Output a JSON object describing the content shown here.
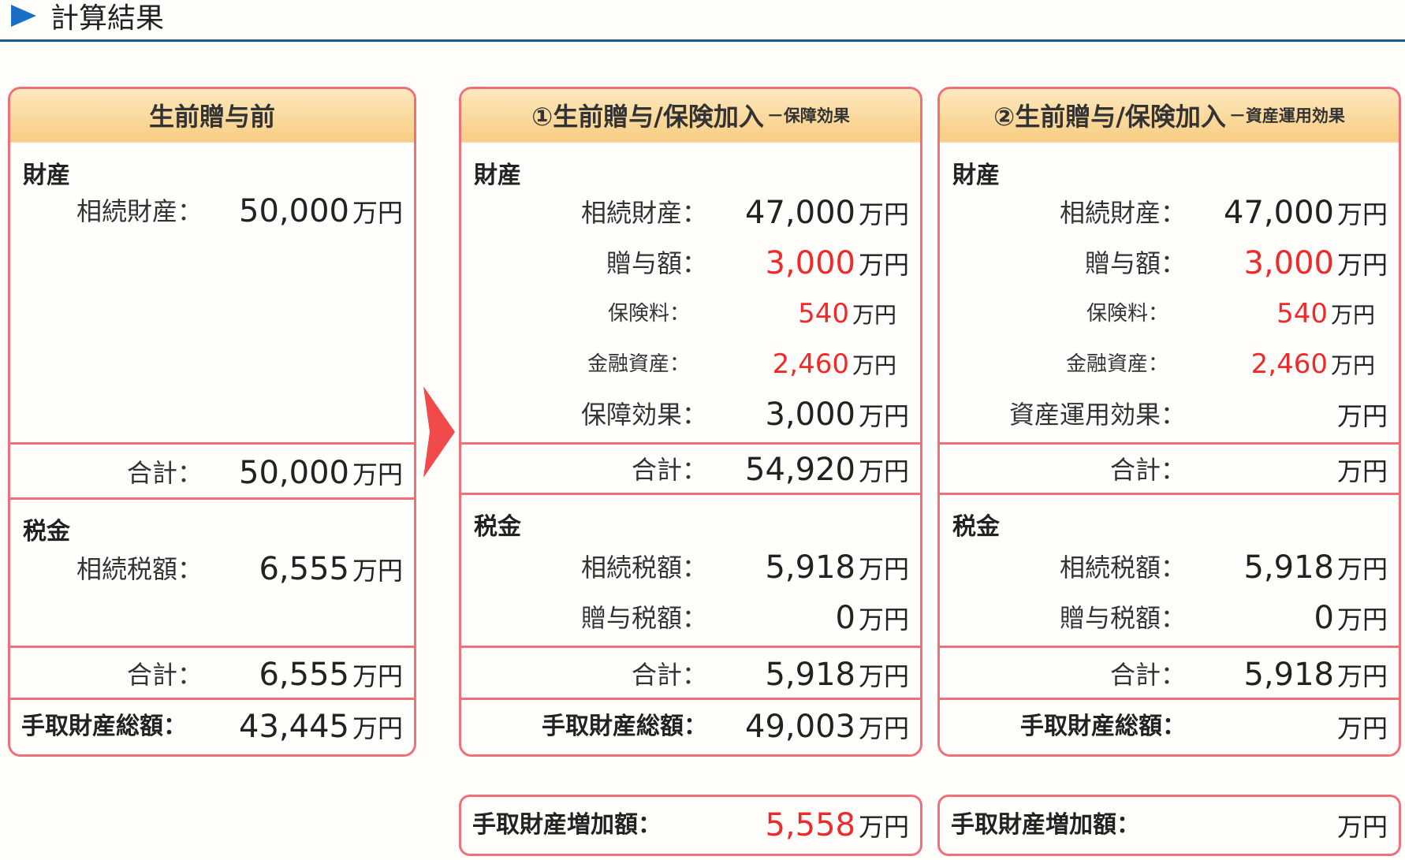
{
  "header": {
    "title": "計算結果"
  },
  "colors": {
    "accent_blue": "#1a6fc4",
    "border_red": "#f0707a",
    "value_red": "#ee2a2a",
    "header_orange": "#f8cd83"
  },
  "panels": [
    {
      "title": "生前贈与前",
      "subtitle": "",
      "assets_title": "財産",
      "assets": [
        {
          "label": "相続財産：",
          "value": "50,000",
          "unit": "万円"
        }
      ],
      "assets_total": {
        "label": "合計：",
        "value": "50,000",
        "unit": "万円"
      },
      "tax_title": "税金",
      "taxes": [
        {
          "label": "相続税額：",
          "value": "6,555",
          "unit": "万円"
        }
      ],
      "tax_total": {
        "label": "合計：",
        "value": "6,555",
        "unit": "万円"
      },
      "net": {
        "label": "手取財産総額：",
        "value": "43,445",
        "unit": "万円"
      }
    },
    {
      "title": "①生前贈与/保険加入",
      "subtitle": "－保障効果",
      "assets_title": "財産",
      "assets": [
        {
          "label": "相続財産：",
          "value": "47,000",
          "unit": "万円"
        },
        {
          "label": "贈与額：",
          "value": "3,000",
          "unit": "万円"
        },
        {
          "label": "保険料：",
          "value": "540",
          "unit": "万円"
        },
        {
          "label": "金融資産：",
          "value": "2,460",
          "unit": "万円"
        },
        {
          "label": "保障効果：",
          "value": "3,000",
          "unit": "万円"
        }
      ],
      "assets_total": {
        "label": "合計：",
        "value": "54,920",
        "unit": "万円"
      },
      "tax_title": "税金",
      "taxes": [
        {
          "label": "相続税額：",
          "value": "5,918",
          "unit": "万円"
        },
        {
          "label": "贈与税額：",
          "value": "0",
          "unit": "万円"
        }
      ],
      "tax_total": {
        "label": "合計：",
        "value": "5,918",
        "unit": "万円"
      },
      "net": {
        "label": "手取財産総額：",
        "value": "49,003",
        "unit": "万円"
      },
      "increase": {
        "label": "手取財産増加額：",
        "value": "5,558",
        "unit": "万円"
      }
    },
    {
      "title": "②生前贈与/保険加入",
      "subtitle": "－資産運用効果",
      "assets_title": "財産",
      "assets": [
        {
          "label": "相続財産：",
          "value": "47,000",
          "unit": "万円"
        },
        {
          "label": "贈与額：",
          "value": "3,000",
          "unit": "万円"
        },
        {
          "label": "保険料：",
          "value": "540",
          "unit": "万円"
        },
        {
          "label": "金融資産：",
          "value": "2,460",
          "unit": "万円"
        },
        {
          "label": "資産運用効果：",
          "value": "",
          "unit": "万円"
        }
      ],
      "assets_total": {
        "label": "合計：",
        "value": "",
        "unit": "万円"
      },
      "tax_title": "税金",
      "taxes": [
        {
          "label": "相続税額：",
          "value": "5,918",
          "unit": "万円"
        },
        {
          "label": "贈与税額：",
          "value": "0",
          "unit": "万円"
        }
      ],
      "tax_total": {
        "label": "合計：",
        "value": "5,918",
        "unit": "万円"
      },
      "net": {
        "label": "手取財産総額：",
        "value": "",
        "unit": "万円"
      },
      "increase": {
        "label": "手取財産増加額：",
        "value": "",
        "unit": "万円"
      }
    }
  ]
}
